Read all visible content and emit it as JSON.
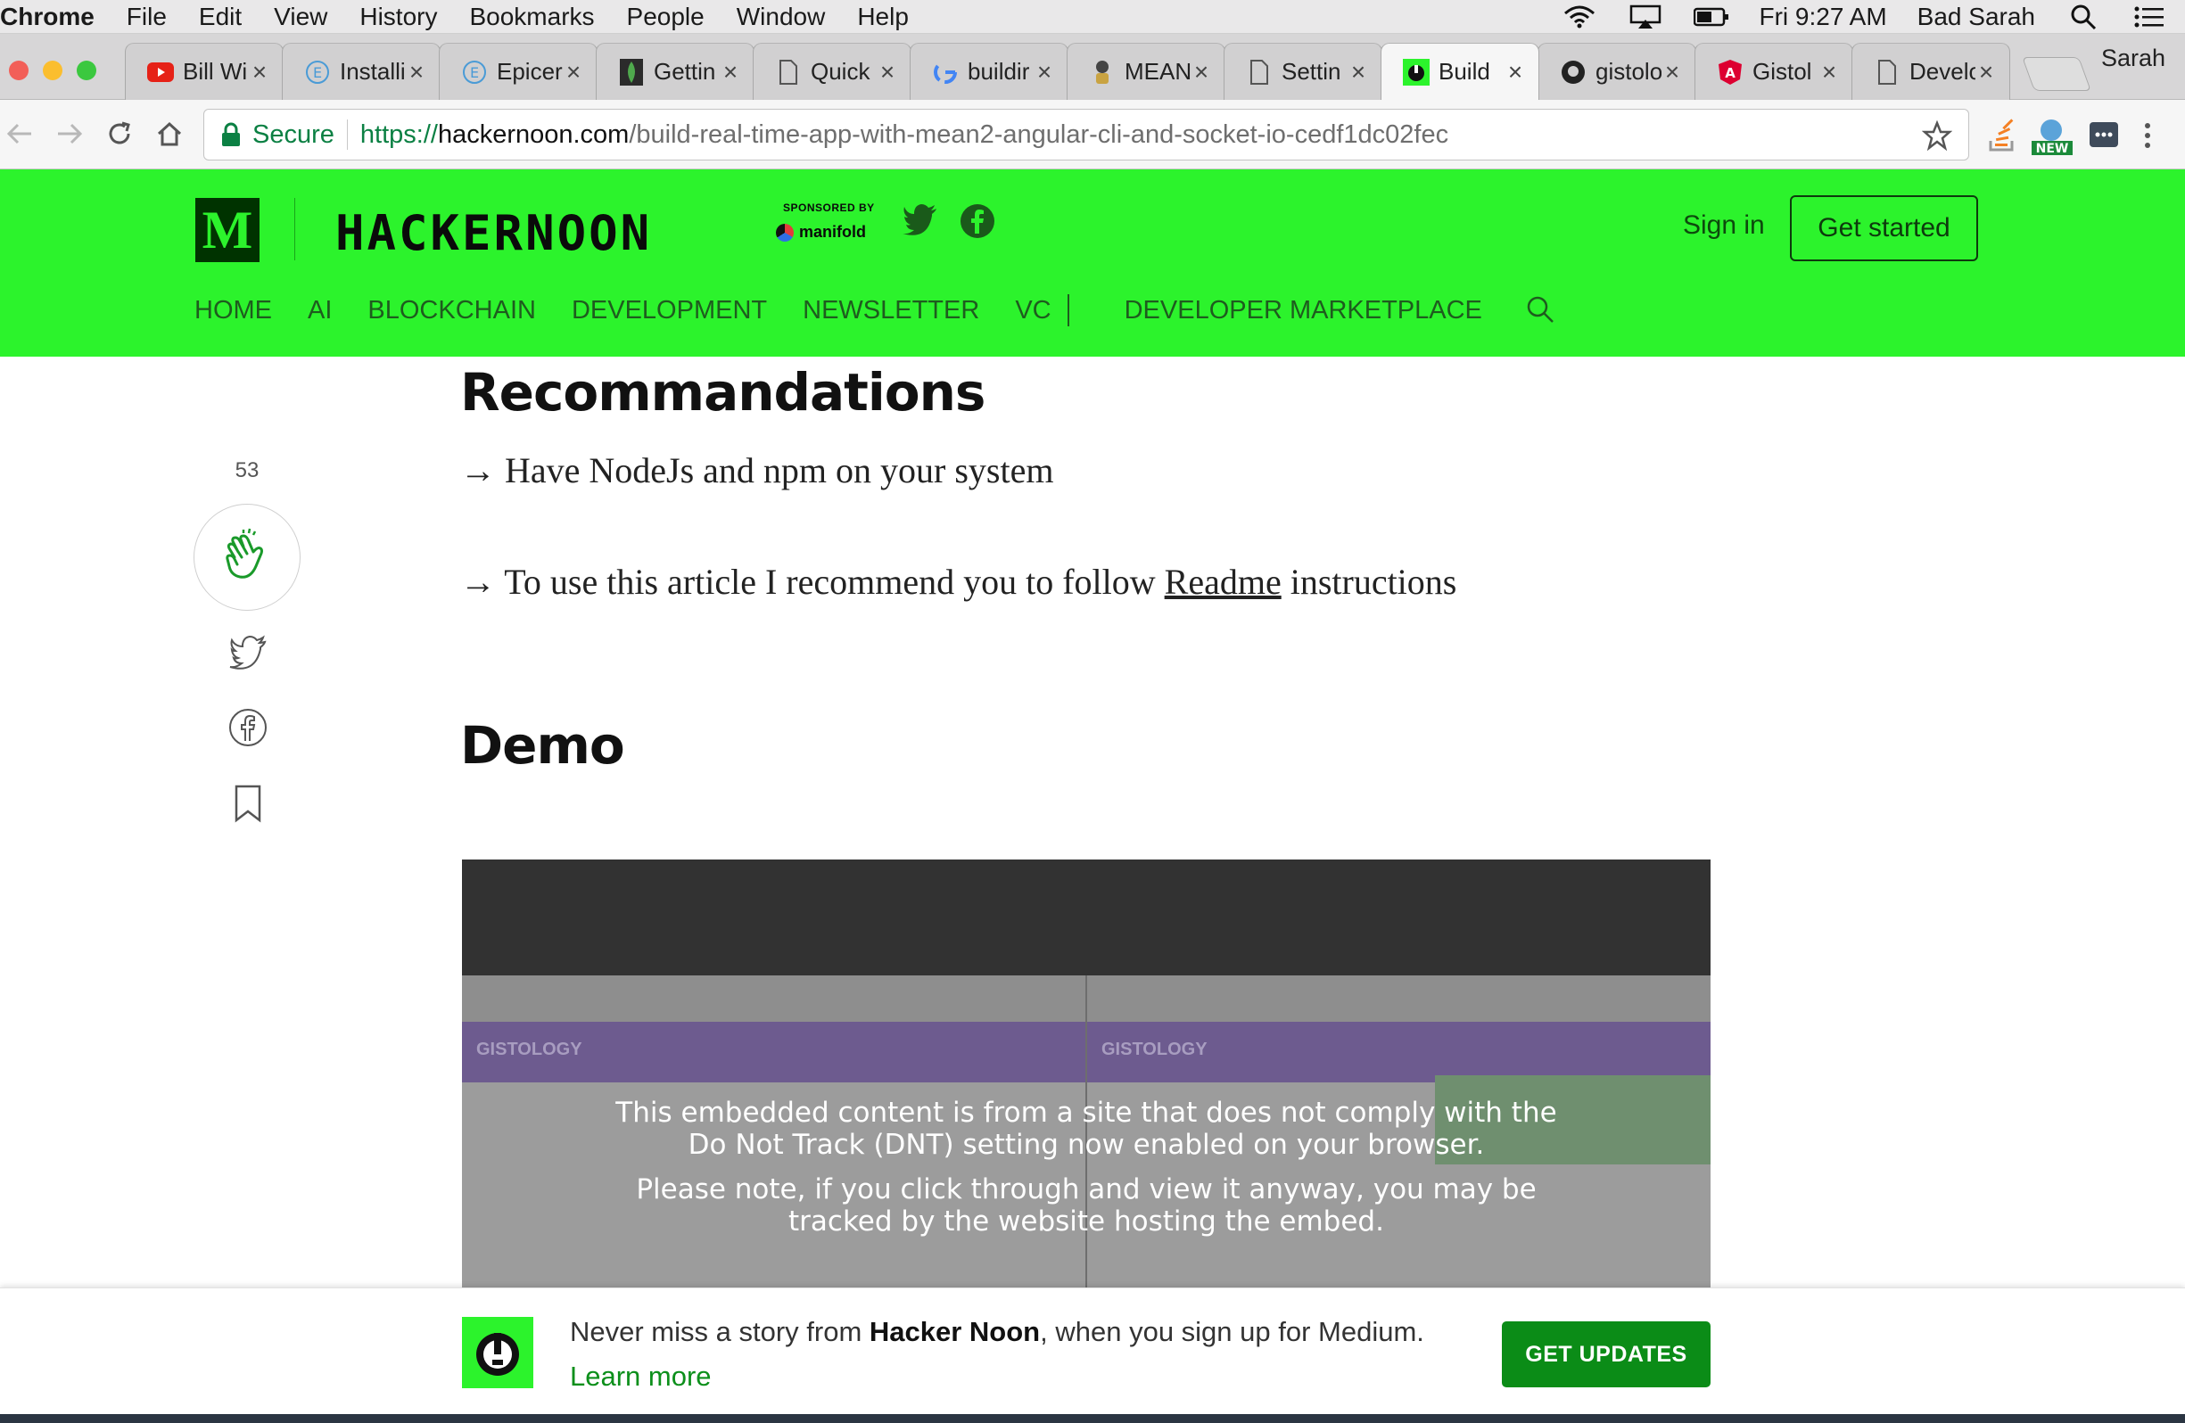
{
  "menubar": {
    "app": "Chrome",
    "items": [
      "File",
      "Edit",
      "View",
      "History",
      "Bookmarks",
      "People",
      "Window",
      "Help"
    ],
    "clock": "Fri 9:27 AM",
    "user": "Bad Sarah"
  },
  "tabs": [
    {
      "title": "Bill Wi",
      "icon": "youtube-icon"
    },
    {
      "title": "Installi",
      "icon": "e-circle-icon"
    },
    {
      "title": "Epicer",
      "icon": "e-circle-icon"
    },
    {
      "title": "Gettin",
      "icon": "mongodb-leaf-icon"
    },
    {
      "title": "Quick",
      "icon": "document-icon"
    },
    {
      "title": "buildir",
      "icon": "google-icon"
    },
    {
      "title": "MEAN",
      "icon": "mean-icon"
    },
    {
      "title": "Settin",
      "icon": "document-icon"
    },
    {
      "title": "Build",
      "icon": "hackernoon-icon"
    },
    {
      "title": "gistolo",
      "icon": "github-icon"
    },
    {
      "title": "Gistol",
      "icon": "angular-icon"
    },
    {
      "title": "Develo",
      "icon": "document-icon"
    }
  ],
  "active_tab_index": 8,
  "profile_name": "Sarah",
  "address": {
    "secure_label": "Secure",
    "scheme": "https://",
    "host": "hackernoon.com",
    "path": "/build-real-time-app-with-mean2-angular-cli-and-socket-io-cedf1dc02fec",
    "ext_badge": "NEW"
  },
  "site": {
    "logo_letter": "M",
    "brand": "HACKERNOON",
    "sponsored_by": "SPONSORED BY",
    "sponsor_name": "manifold",
    "sign_in": "Sign in",
    "get_started": "Get started",
    "nav": [
      "HOME",
      "AI",
      "BLOCKCHAIN",
      "DEVELOPMENT",
      "NEWSLETTER",
      "VC"
    ],
    "nav_extra": "DEVELOPER MARKETPLACE"
  },
  "article": {
    "heading_recommendations": "Recommandations",
    "line1": "→ Have NodeJs and npm on your system",
    "line2_prefix": "→ To use this article I recommend you to follow ",
    "line2_link": "Readme",
    "line2_suffix": " instructions",
    "heading_demo": "Demo",
    "clap_count": "53"
  },
  "embed": {
    "app_label_left": "GISTOLOGY",
    "app_label_right": "GISTOLOGY",
    "notice_1": "This embedded content is from a site that does not comply with the Do Not Track (DNT) setting now enabled on your browser.",
    "notice_2": "Please note, if you click through and view it anyway, you may be tracked by the website hosting the embed."
  },
  "banner": {
    "text_before": "Never miss a story from ",
    "publication": "Hacker Noon",
    "text_after": ", when you sign up for Medium. ",
    "learn_more": "Learn more",
    "button": "GET UPDATES"
  },
  "colors": {
    "brand_green": "#2cf32c",
    "cta_green": "#0b8c17",
    "secure_green": "#0b8043"
  }
}
